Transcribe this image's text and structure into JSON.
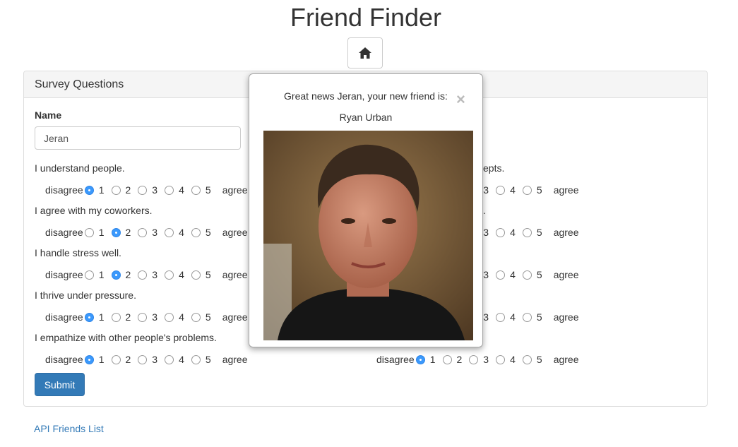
{
  "page": {
    "title": "Friend Finder"
  },
  "home_button": {
    "icon": "home-icon"
  },
  "survey": {
    "heading": "Survey Questions",
    "name_label": "Name",
    "name_value": "Jeran",
    "disagree_label": "disagree",
    "agree_label": "agree",
    "options": [
      "1",
      "2",
      "3",
      "4",
      "5"
    ],
    "left_questions": [
      {
        "text": "I understand people.",
        "selected": 1
      },
      {
        "text": "I agree with my coworkers.",
        "selected": 2
      },
      {
        "text": "I handle stress well.",
        "selected": 2
      },
      {
        "text": "I thrive under pressure.",
        "selected": 1
      },
      {
        "text": "I empathize with other people's problems.",
        "selected": 1
      }
    ],
    "right_questions": [
      {
        "text_fragment": "epts.",
        "selected": null
      },
      {
        "text_fragment": ".",
        "selected": null
      },
      {
        "text_fragment": "",
        "selected": null
      },
      {
        "text_fragment": "",
        "selected": null
      },
      {
        "text_fragment": "",
        "selected": 1
      }
    ],
    "submit_label": "Submit"
  },
  "footer": {
    "api_link": "API Friends List"
  },
  "modal": {
    "message": "Great news Jeran, your new friend is:",
    "friend_name": "Ryan Urban",
    "close_symbol": "×"
  },
  "colors": {
    "primary": "#337ab7",
    "radio_selected": "#3b99fc",
    "link": "#337ab7"
  }
}
